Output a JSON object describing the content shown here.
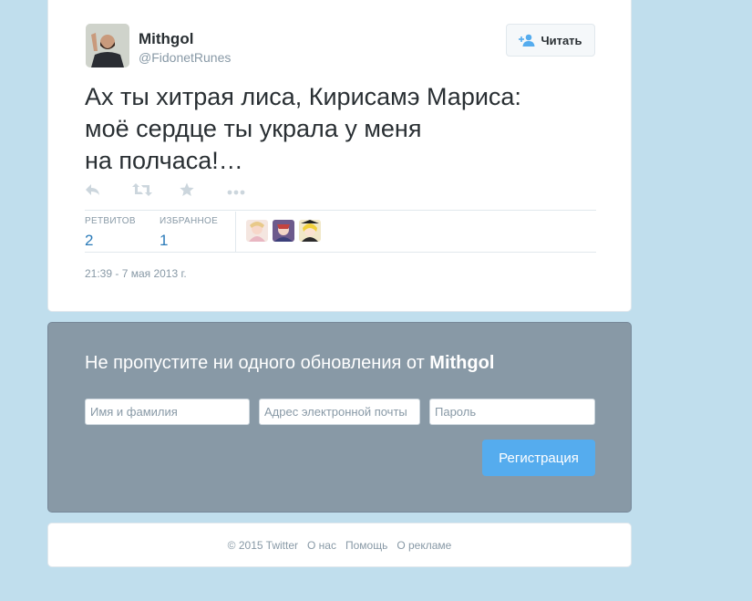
{
  "tweet": {
    "author_name": "Mithgol",
    "author_handle": "@FidonetRunes",
    "follow_label": "Читать",
    "text": "Ах ты хитрая лиса, Кирисамэ Мариса:\nмоё сердце ты украла у меня\nна полчаса!…",
    "actions": [
      "reply-icon",
      "retweet-icon",
      "favorite-icon",
      "more-icon"
    ],
    "stats": {
      "retweets_label": "РЕТВИТОВ",
      "retweets_count": "2",
      "favorites_label": "ИЗБРАННОЕ",
      "favorites_count": "1"
    },
    "timestamp": "21:39 - 7 мая 2013 г."
  },
  "signup": {
    "title_prefix": "Не пропустите ни одного обновления от ",
    "title_user": "Mithgol",
    "name_placeholder": "Имя и фамилия",
    "email_placeholder": "Адрес электронной почты",
    "password_placeholder": "Пароль",
    "submit_label": "Регистрация"
  },
  "footer": {
    "copyright": "© 2015 Twitter",
    "links": [
      "О нас",
      "Помощь",
      "О рекламе"
    ]
  },
  "colors": {
    "background": "#c0deed",
    "link": "#2b7bb9",
    "signup_panel": "#8899a6",
    "button": "#55acee"
  }
}
